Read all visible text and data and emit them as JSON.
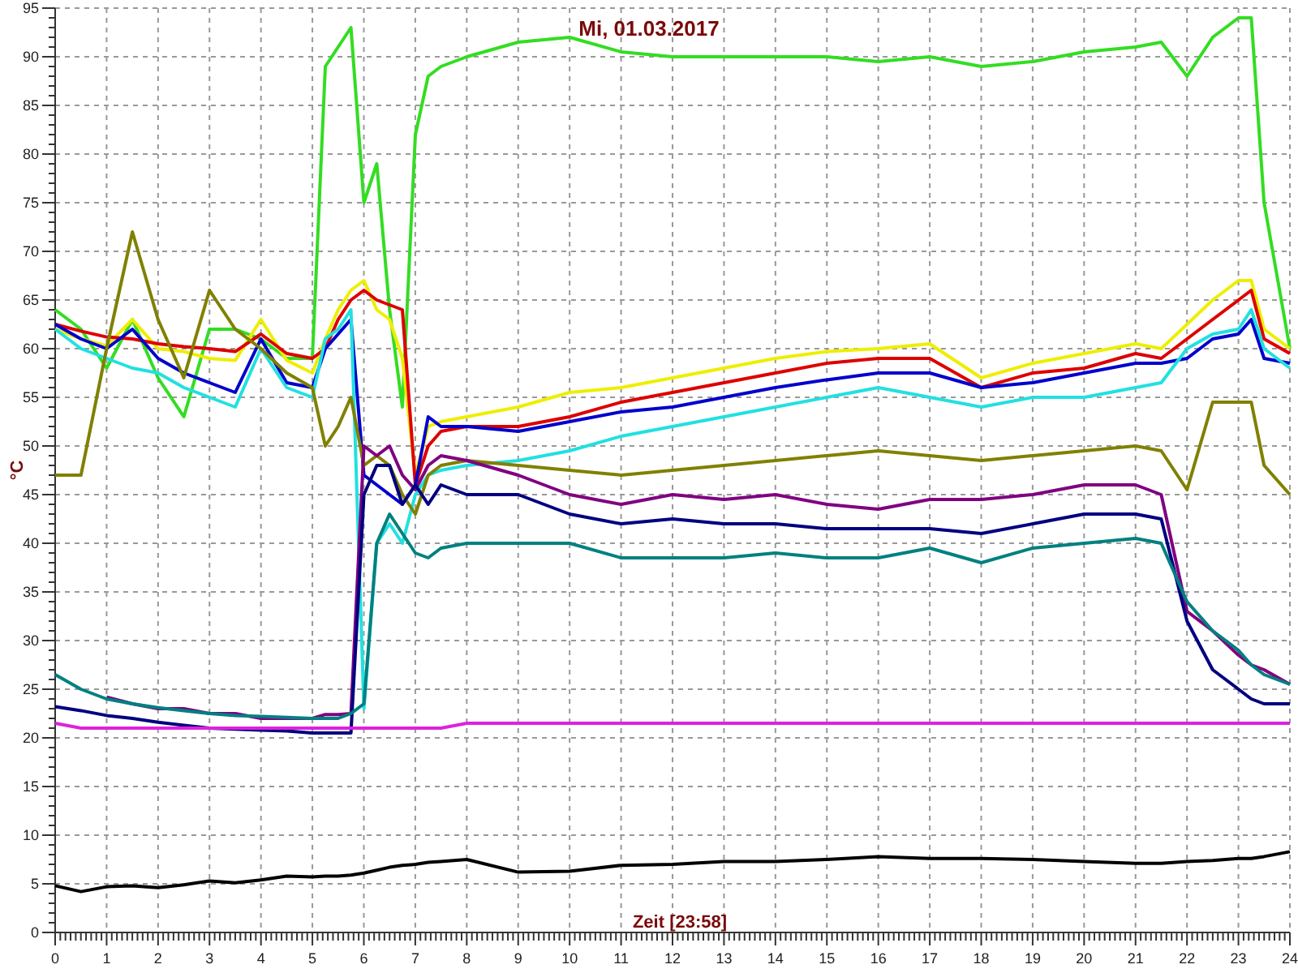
{
  "chart": {
    "chart_data": {
      "type": "line",
      "title": "Mi, 01.03.2017",
      "xlabel": "Zeit [23:58]",
      "ylabel": "°C",
      "x": [
        0,
        0.5,
        1,
        1.5,
        2,
        2.5,
        3,
        3.5,
        4,
        4.5,
        5,
        5.25,
        5.5,
        5.75,
        6,
        6.25,
        6.5,
        6.75,
        7,
        7.25,
        7.5,
        8,
        9,
        10,
        11,
        12,
        13,
        14,
        15,
        16,
        17,
        18,
        19,
        20,
        21,
        21.5,
        22,
        22.5,
        23,
        23.25,
        23.5,
        24
      ],
      "series": [
        {
          "color": "#33dd22",
          "values": [
            64,
            62,
            58,
            63,
            57,
            53,
            62,
            62,
            61,
            59,
            59,
            89,
            91,
            93,
            75,
            79,
            64,
            54,
            82,
            88,
            89,
            90,
            91.5,
            92,
            90.5,
            90,
            90,
            90,
            90,
            89.5,
            90,
            89,
            89.5,
            90.5,
            91,
            91.5,
            88,
            92,
            94,
            94,
            75,
            60
          ]
        },
        {
          "color": "#eeee00",
          "values": [
            62,
            61,
            60.3,
            63,
            60,
            59.7,
            59,
            58.8,
            63,
            58.8,
            57.5,
            61,
            64,
            66,
            67,
            64,
            63,
            59,
            47,
            52,
            52.5,
            53,
            54,
            55.5,
            56,
            57,
            58,
            59,
            59.7,
            60,
            60.5,
            57,
            58.5,
            59.5,
            60.5,
            60,
            62.5,
            65,
            67,
            67,
            62,
            60
          ]
        },
        {
          "color": "#dd0000",
          "values": [
            62.5,
            61.8,
            61.2,
            61,
            60.5,
            60.2,
            60,
            59.7,
            61.5,
            59.5,
            59,
            60,
            63,
            65,
            66,
            65,
            64.5,
            64,
            46,
            50,
            51.5,
            52,
            52,
            53,
            54.5,
            55.5,
            56.5,
            57.5,
            58.5,
            59,
            59,
            56,
            57.5,
            58,
            59.5,
            59,
            61,
            63,
            65,
            66,
            61,
            59.5
          ]
        },
        {
          "color": "#0000cc",
          "values": [
            62.5,
            61,
            60,
            62,
            59,
            57.5,
            56.5,
            55.5,
            61,
            56.5,
            56,
            60,
            61.5,
            63,
            47,
            46,
            45,
            44,
            46,
            53,
            52,
            52,
            51.5,
            52.5,
            53.5,
            54,
            55,
            56,
            56.8,
            57.5,
            57.5,
            56,
            56.5,
            57.5,
            58.5,
            58.5,
            59,
            61,
            61.5,
            63,
            59,
            58.5
          ]
        },
        {
          "color": "#22e0e0",
          "values": [
            62,
            60,
            59,
            58,
            57.5,
            56,
            55,
            54,
            60,
            56,
            55,
            61,
            62,
            64,
            23,
            40,
            42,
            40,
            45,
            47,
            47.5,
            48,
            48.5,
            49.5,
            51,
            52,
            53,
            54,
            55,
            56,
            55,
            54,
            55,
            55,
            56,
            56.5,
            60,
            61.5,
            62,
            64,
            60,
            58
          ]
        },
        {
          "color": "#808000",
          "values": [
            47,
            47,
            60,
            72,
            63,
            57,
            66,
            62,
            60,
            57.5,
            56,
            50,
            52,
            55,
            48,
            49,
            48,
            45,
            43,
            47,
            48,
            48.5,
            48,
            47.5,
            47,
            47.5,
            48,
            48.5,
            49,
            49.5,
            49,
            48.5,
            49,
            49.5,
            50,
            49.5,
            45.5,
            54.5,
            54.5,
            54.5,
            48,
            45
          ]
        },
        {
          "color": "#800080",
          "values": [
            null,
            null,
            24.2,
            23.5,
            23,
            23,
            22.5,
            22.5,
            22,
            22,
            22,
            22.4,
            22.4,
            22.5,
            50,
            49,
            50,
            47,
            45.5,
            48,
            49,
            48.5,
            47,
            45,
            44,
            45,
            44.5,
            45,
            44,
            43.5,
            44.5,
            44.5,
            45,
            46,
            46,
            45,
            33,
            31,
            28.5,
            27.5,
            27,
            25.5
          ]
        },
        {
          "color": "#000080",
          "values": [
            23.2,
            22.8,
            22.3,
            22,
            21.6,
            21.3,
            21,
            20.9,
            20.8,
            20.7,
            20.5,
            20.5,
            20.5,
            20.5,
            45,
            48,
            48,
            44,
            46,
            44,
            46,
            45,
            45,
            43,
            42,
            42.5,
            42,
            42,
            41.5,
            41.5,
            41.5,
            41,
            42,
            43,
            43,
            42.5,
            32,
            27,
            25,
            24,
            23.5,
            23.5
          ]
        },
        {
          "color": "#008080",
          "values": [
            26.5,
            25,
            24,
            23.5,
            23.1,
            22.8,
            22.5,
            22.3,
            22.2,
            22.1,
            22,
            22,
            22,
            22.5,
            23.5,
            40,
            43,
            41,
            39,
            38.5,
            39.5,
            40,
            40,
            40,
            38.5,
            38.5,
            38.5,
            39,
            38.5,
            38.5,
            39.5,
            38,
            39.5,
            40,
            40.5,
            40,
            34,
            31,
            29,
            27.5,
            26.5,
            25.5
          ]
        },
        {
          "color": "#dd22dd",
          "values": [
            21.5,
            21,
            21,
            21,
            21,
            21,
            21,
            21,
            21,
            21,
            21,
            21,
            21,
            21,
            21,
            21,
            21,
            21,
            21,
            21,
            21,
            21.5,
            21.5,
            21.5,
            21.5,
            21.5,
            21.5,
            21.5,
            21.5,
            21.5,
            21.5,
            21.5,
            21.5,
            21.5,
            21.5,
            21.5,
            21.5,
            21.5,
            21.5,
            21.5,
            21.5,
            21.5
          ]
        },
        {
          "color": "#000000",
          "values": [
            4.8,
            4.2,
            4.7,
            4.8,
            4.6,
            4.9,
            5.3,
            5.1,
            5.4,
            5.8,
            5.7,
            5.8,
            5.8,
            5.9,
            6.1,
            6.4,
            6.7,
            6.9,
            7,
            7.2,
            7.3,
            7.5,
            6.2,
            6.3,
            6.9,
            7,
            7.3,
            7.3,
            7.5,
            7.8,
            7.6,
            7.6,
            7.5,
            7.3,
            7.1,
            7.1,
            7.3,
            7.4,
            7.6,
            7.6,
            7.8,
            8.3
          ]
        }
      ],
      "xlim": [
        0,
        24
      ],
      "ylim": [
        0,
        95
      ],
      "xticks": [
        0,
        1,
        2,
        3,
        4,
        5,
        6,
        7,
        8,
        9,
        10,
        11,
        12,
        13,
        14,
        15,
        16,
        17,
        18,
        19,
        20,
        21,
        22,
        23,
        24
      ],
      "yticks": [
        0,
        5,
        10,
        15,
        20,
        25,
        30,
        35,
        40,
        45,
        50,
        55,
        60,
        65,
        70,
        75,
        80,
        85,
        90,
        95
      ],
      "grid": true
    }
  }
}
